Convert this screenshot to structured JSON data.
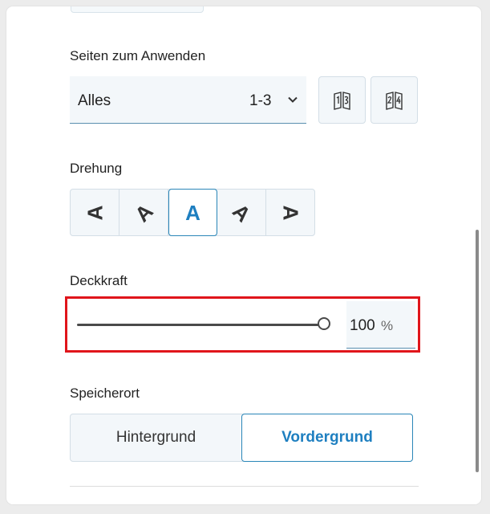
{
  "pages": {
    "label": "Seiten zum Anwenden",
    "selected": "Alles",
    "range": "1-3",
    "odd_pages_icon": "odd-pages-icon",
    "even_pages_icon": "even-pages-icon"
  },
  "rotation": {
    "label": "Drehung",
    "glyph": "A",
    "options": [
      "rotate-left-90",
      "rotate-left-45",
      "rotate-0",
      "rotate-right-45",
      "rotate-right-90"
    ],
    "active_index": 2
  },
  "opacity": {
    "label": "Deckkraft",
    "value": "100",
    "unit": "%",
    "level_percent": 100
  },
  "location": {
    "label": "Speicherort",
    "background": "Hintergrund",
    "foreground": "Vordergrund",
    "selected": "Vordergrund"
  },
  "colors": {
    "accent": "#1e7fc0",
    "highlight_border": "#e0151b"
  }
}
